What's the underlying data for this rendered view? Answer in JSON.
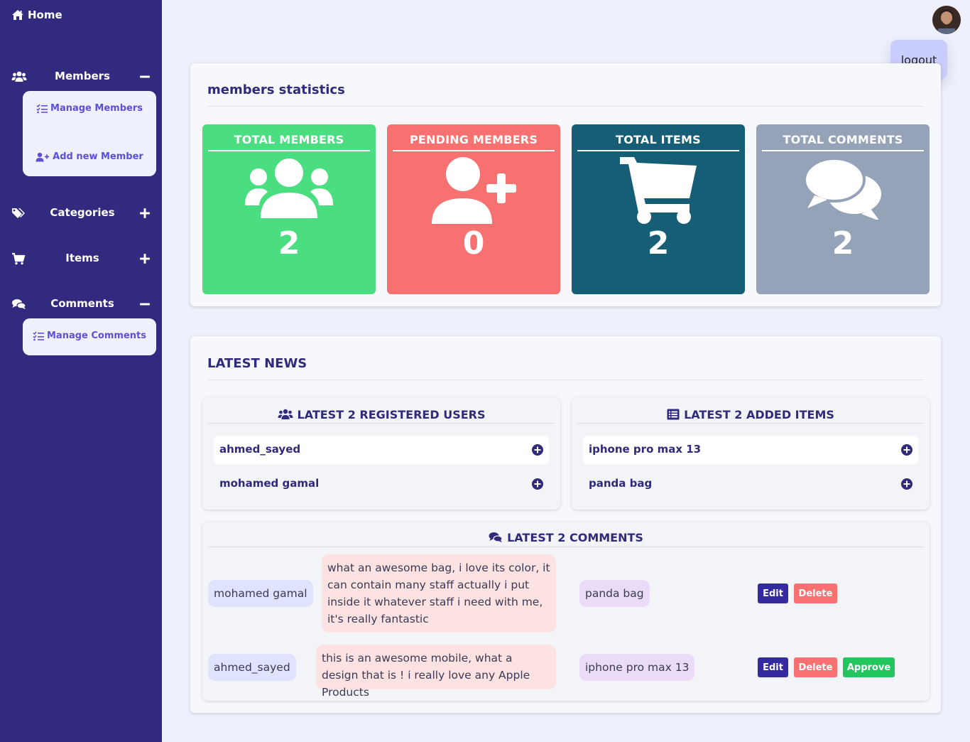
{
  "sidebar": {
    "home_label": "Home",
    "members": {
      "label": "Members",
      "toggle": "minus",
      "items": [
        {
          "label": "Manage Members"
        },
        {
          "label": "Add new Member"
        }
      ]
    },
    "categories": {
      "label": "Categories",
      "toggle": "plus"
    },
    "items": {
      "label": "Items",
      "toggle": "plus"
    },
    "comments": {
      "label": "Comments",
      "toggle": "minus",
      "items": [
        {
          "label": "Manage Comments"
        }
      ]
    }
  },
  "header": {
    "logout_label": "logout"
  },
  "stats_panel": {
    "title": "members statistics",
    "cards": [
      {
        "title": "TOTAL MEMBERS",
        "value": "2",
        "color": "#4ade80",
        "icon": "users-icon"
      },
      {
        "title": "PENDING MEMBERS",
        "value": "0",
        "color": "#f87171",
        "icon": "user-plus-icon"
      },
      {
        "title": "TOTAL ITEMS",
        "value": "2",
        "color": "#155e75",
        "icon": "cart-icon"
      },
      {
        "title": "TOTAL COMMENTS",
        "value": "2",
        "color": "#94a3b8",
        "icon": "comments-icon"
      }
    ]
  },
  "news_panel": {
    "title": "LATEST NEWS",
    "users_card": {
      "title": "LATEST 2 REGISTERED USERS",
      "rows": [
        {
          "name": "ahmed_sayed"
        },
        {
          "name": "mohamed gamal"
        }
      ]
    },
    "items_card": {
      "title": "LATEST 2 ADDED ITEMS",
      "rows": [
        {
          "name": "iphone pro max 13"
        },
        {
          "name": "panda bag"
        }
      ]
    },
    "comments_card": {
      "title": "LATEST 2 COMMENTS",
      "rows": [
        {
          "user": "mohamed gamal",
          "comment": "what an awesome bag, i love its color, it can contain many staff actually i put inside it whatever staff i need with me, it's really fantastic",
          "item": "panda bag",
          "edit": "Edit",
          "delete": "Delete"
        },
        {
          "user": "ahmed_sayed",
          "comment": "this is an awesome mobile, what a design that is ! i really love any Apple Products",
          "item": "iphone pro max 13",
          "edit": "Edit",
          "delete": "Delete",
          "approve": "Approve"
        }
      ]
    }
  },
  "colors": {
    "sidebar_bg": "#322a7e",
    "page_bg": "#eef1fb",
    "accent_text": "#2f2a7a",
    "submenu_link": "#5b51d6"
  }
}
